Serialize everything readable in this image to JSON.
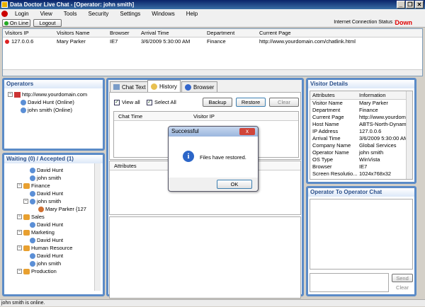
{
  "window": {
    "title": "Data Doctor Live Chat - [Operator: john smith]"
  },
  "menu": [
    "Login",
    "View",
    "Tools",
    "Security",
    "Settings",
    "Windows",
    "Help"
  ],
  "toolbar": {
    "online_label": "On Line",
    "logout_label": "Logout",
    "connection_label": "Internet Connection Status :",
    "connection_value": "Down"
  },
  "visitors": {
    "columns": [
      "Visitors IP",
      "Visitors Name",
      "Browser",
      "Arrival Time",
      "Department",
      "Current Page"
    ],
    "rows": [
      [
        "127.0.0.6",
        "Mary Parker",
        "IE7",
        "3/6/2009 5:30:00 AM",
        "Finance",
        "http://www.yourdomain.com/chatlink.html"
      ]
    ]
  },
  "operators": {
    "title": "Operators",
    "root": "http://www.yourdomain.com",
    "items": [
      "David Hunt (Online)",
      "john smith (Online)"
    ]
  },
  "waiting": {
    "title": "Waiting (0) / Accepted (1)",
    "tree": [
      "David Hunt",
      "john smith",
      "Finance",
      "David Hunt",
      "john smith",
      "Mary Parker {127",
      "Sales",
      "David Hunt",
      "Marketing",
      "David Hunt",
      "Human Resource",
      "David Hunt",
      "john smith",
      "Production"
    ]
  },
  "tabs": [
    "Chat Text",
    "History",
    "Browser"
  ],
  "history": {
    "view_all": "View all",
    "select_all": "Select All",
    "backup": "Backup",
    "restore": "Restore",
    "clear": "Clear",
    "col_chat_time": "Chat Time",
    "col_visitor_ip": "Visitor IP",
    "col_attributes": "Attributes"
  },
  "visitor_details": {
    "title": "Visitor Details",
    "col_attributes": "Attributes",
    "col_information": "Information",
    "rows": [
      [
        "Visitor Name",
        "Mary Parker"
      ],
      [
        "Department",
        "Finance"
      ],
      [
        "Current Page",
        "http://www.yourdoma"
      ],
      [
        "Host Name",
        "ABTS-North-Dynami"
      ],
      [
        "IP Address",
        "127.0.0.6"
      ],
      [
        "Arrival Time",
        "3/6/2009 5:30:00 AM"
      ],
      [
        "Company Name",
        "Global Services"
      ],
      [
        "Operator Name",
        "john smith"
      ],
      [
        "OS Type",
        "WinVista"
      ],
      [
        "Browser",
        "IE7"
      ],
      [
        "Screen Resolutio...",
        "1024x768x32"
      ]
    ]
  },
  "op_chat": {
    "title": "Operator To Operator Chat",
    "send": "Send",
    "clear": "Clear"
  },
  "dialog": {
    "title": "Successful",
    "close": "x",
    "message": "Files have restored.",
    "ok": "OK"
  },
  "status": {
    "text": "john smith is online."
  }
}
